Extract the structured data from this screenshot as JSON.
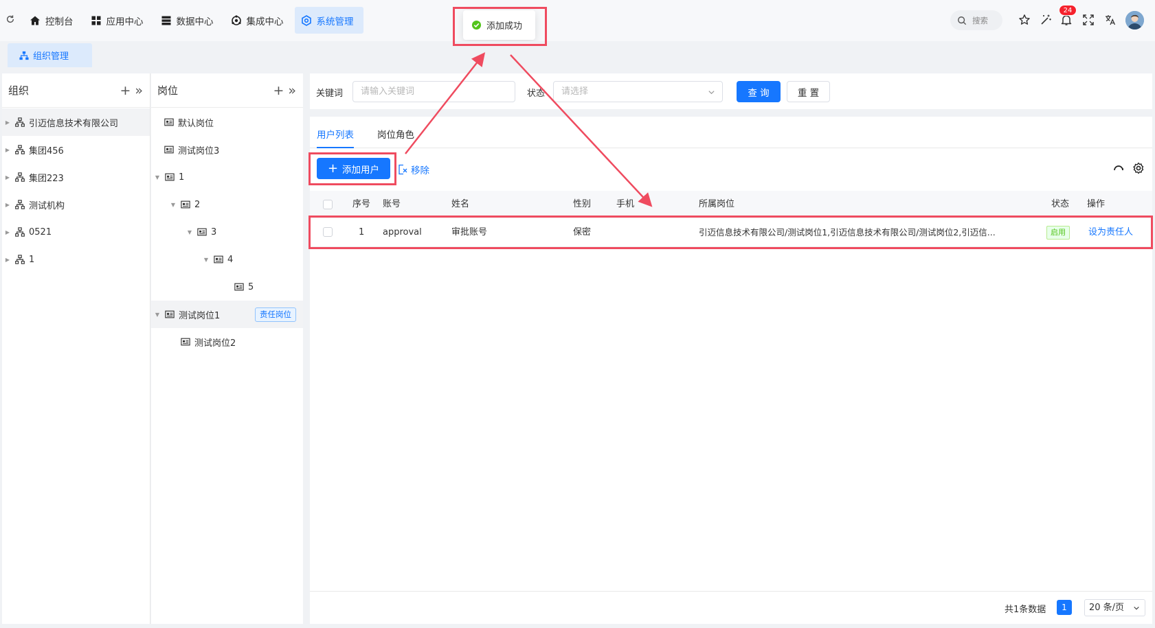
{
  "topbar": {
    "nav": [
      {
        "label": "控制台",
        "icon": "home-icon"
      },
      {
        "label": "应用中心",
        "icon": "apps-icon"
      },
      {
        "label": "数据中心",
        "icon": "database-icon"
      },
      {
        "label": "集成中心",
        "icon": "integration-icon"
      },
      {
        "label": "系统管理",
        "icon": "settings-icon",
        "active": true
      }
    ],
    "search_label": "搜索",
    "notification_count": "24"
  },
  "toast": {
    "message": "添加成功"
  },
  "page_tab": {
    "label": "组织管理"
  },
  "org_panel": {
    "title": "组织",
    "items": [
      {
        "label": "引迈信息技术有限公司"
      },
      {
        "label": "集团456"
      },
      {
        "label": "集团223"
      },
      {
        "label": "测试机构"
      },
      {
        "label": "0521"
      },
      {
        "label": "1"
      }
    ]
  },
  "pos_panel": {
    "title": "岗位",
    "items": [
      {
        "label": "默认岗位"
      },
      {
        "label": "测试岗位3"
      },
      {
        "label": "1"
      },
      {
        "label": "2"
      },
      {
        "label": "3"
      },
      {
        "label": "4"
      },
      {
        "label": "5"
      },
      {
        "label": "测试岗位1",
        "tag": "责任岗位"
      },
      {
        "label": "测试岗位2"
      }
    ]
  },
  "filter": {
    "keyword_label": "关键词",
    "keyword_placeholder": "请输入关键词",
    "status_label": "状态",
    "status_placeholder": "请选择",
    "query_label": "查 询",
    "reset_label": "重 置"
  },
  "main": {
    "tabs": [
      {
        "label": "用户列表",
        "active": true
      },
      {
        "label": "岗位角色"
      }
    ],
    "add_user_label": "添加用户",
    "remove_label": "移除",
    "columns": [
      "序号",
      "账号",
      "姓名",
      "性别",
      "手机",
      "所属岗位",
      "状态",
      "操作"
    ],
    "rows": [
      {
        "index": "1",
        "account": "approval",
        "name": "审批账号",
        "gender": "保密",
        "phone": "",
        "positions": "引迈信息技术有限公司/测试岗位1,引迈信息技术有限公司/测试岗位2,引迈信...",
        "status": "启用",
        "action": "设为责任人"
      }
    ],
    "total_text": "共1条数据",
    "current_page": "1",
    "page_size": "20 条/页"
  },
  "colors": {
    "primary": "#1677ff",
    "highlight_red": "#ef4b5f",
    "success": "#52c41a",
    "badge_red": "#f5222d"
  }
}
